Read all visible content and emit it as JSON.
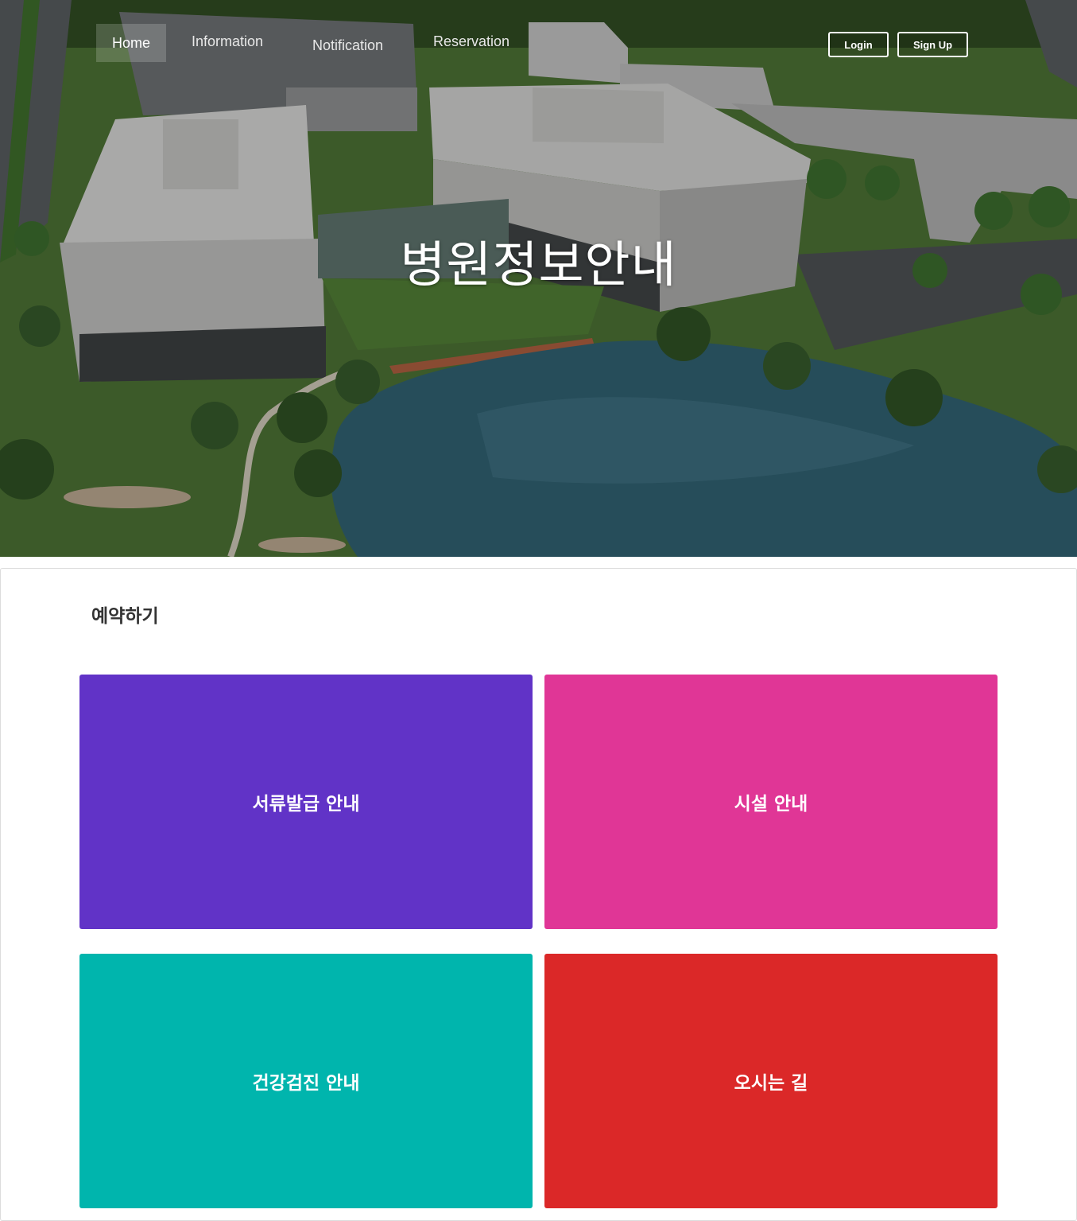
{
  "nav": {
    "items": [
      {
        "label": "Home"
      },
      {
        "label": "Information"
      },
      {
        "label": "Notification"
      },
      {
        "label": "Reservation"
      }
    ],
    "login_label": "Login",
    "signup_label": "Sign Up"
  },
  "hero": {
    "title": "병원정보안내"
  },
  "section": {
    "title": "예약하기",
    "tiles": [
      {
        "label": "서류발급 안내",
        "color": "#6133c7"
      },
      {
        "label": "시설 안내",
        "color": "#e03696"
      },
      {
        "label": "건강검진 안내",
        "color": "#00b5ad"
      },
      {
        "label": "오시는 길",
        "color": "#db2828"
      }
    ]
  }
}
